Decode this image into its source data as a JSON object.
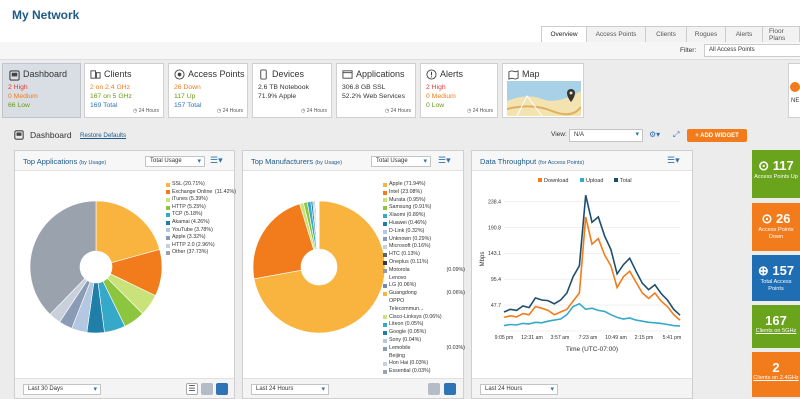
{
  "header": {
    "title": "My Network"
  },
  "tabs": [
    "Overview",
    "Access Points",
    "Clients",
    "Rogues",
    "Alerts",
    "Floor Plans"
  ],
  "filter": {
    "label": "Filter:",
    "value": "All Access Points"
  },
  "cards": {
    "dashboard": {
      "label": "Dashboard"
    },
    "clients": {
      "title": "Clients",
      "l1": "2 on 2.4 GHz",
      "l2": "167 on 5 GHz",
      "l3": "169 Total",
      "time": "24 Hours"
    },
    "access_points": {
      "title": "Access Points",
      "l1": "26 Down",
      "l2": "117 Up",
      "l3": "157 Total",
      "time": "24 Hours"
    },
    "devices": {
      "title": "Devices",
      "l1": "2.6 TB Notebook",
      "l2": "71.9% Apple",
      "time": "24 Hours"
    },
    "applications": {
      "title": "Applications",
      "l1": "306.8 GB SSL",
      "l2": "52.2% Web Services",
      "time": "24 Hours"
    },
    "alerts": {
      "title": "Alerts",
      "l1": "2 High",
      "l2": "0 Medium",
      "l3": "0 Low",
      "time": "24 Hours"
    },
    "map": {
      "title": "Map"
    },
    "partial": {
      "label": "NE"
    }
  },
  "dashboard_left": {
    "high": "2 High",
    "medium": "0 Medium",
    "low": "66 Low"
  },
  "dashbar": {
    "title": "Dashboard",
    "restore": "Restore Defaults",
    "view_label": "View:",
    "view_value": "N/A",
    "add_widget": "+ ADD WIDGET"
  },
  "panel_apps": {
    "title": "Top Applications",
    "sub": "(by Usage)",
    "select": "Total Usage",
    "footer_select": "Last 30 Days",
    "legend": [
      {
        "label": "SSL (20.71%)",
        "color": "#f9b43f"
      },
      {
        "label": "Exchange Online",
        "pct": "(11.42%)",
        "color": "#f27c1b"
      },
      {
        "label": "iTunes (5.39%)",
        "color": "#c9e37a"
      },
      {
        "label": "HTTP (5.25%)",
        "color": "#8cc63f"
      },
      {
        "label": "TCP (5.18%)",
        "color": "#36a9c9"
      },
      {
        "label": "Akamai (4.26%)",
        "color": "#1f7fa8"
      },
      {
        "label": "YouTube (3.78%)",
        "color": "#b3c7e0"
      },
      {
        "label": "Apple (3.32%)",
        "color": "#8a9bb5"
      },
      {
        "label": "HTTP 2.0 (2.96%)",
        "color": "#c8d0db"
      },
      {
        "label": "Other (37.73%)",
        "color": "#9aa3ad"
      }
    ]
  },
  "panel_mfr": {
    "title": "Top Manufacturers",
    "sub": "(by Usage)",
    "select": "Total Usage",
    "footer_select": "Last 24 Hours",
    "legend": [
      {
        "label": "Apple (71.94%)",
        "color": "#f9b43f"
      },
      {
        "label": "Intel (23.08%)",
        "color": "#f27c1b"
      },
      {
        "label": "Murata (0.95%)",
        "color": "#c9e37a"
      },
      {
        "label": "Samsung (0.91%)",
        "color": "#8cc63f"
      },
      {
        "label": "Xiaomi (0.89%)",
        "color": "#36a9c9"
      },
      {
        "label": "Huawei (0.46%)",
        "color": "#1f7fa8"
      },
      {
        "label": "D-Link (0.32%)",
        "color": "#b3c7e0"
      },
      {
        "label": "Unknown (0.29%)",
        "color": "#8a9bb5"
      },
      {
        "label": "Microsoft (0.16%)",
        "color": "#c8d0db"
      },
      {
        "label": "HTC (0.13%)",
        "color": "#5a6470"
      },
      {
        "label": "Oneplus (0.11%)",
        "color": "#2b3a55"
      },
      {
        "label": "Motorola",
        "pct": "(0.09%)",
        "color": "#8a9bb5"
      },
      {
        "label": "Lenovo",
        "pct": "",
        "color": ""
      },
      {
        "label": "LG (0.06%)",
        "color": "#6e8bb5"
      },
      {
        "label": "Guangdong",
        "pct": "(0.06%)",
        "color": "#f9b43f"
      },
      {
        "label": "OPPO",
        "pct": "",
        "color": ""
      },
      {
        "label": "Telecommun...",
        "pct": "",
        "color": ""
      },
      {
        "label": "Cisco-Linksys (0.06%)",
        "color": "#c9e37a"
      },
      {
        "label": "Liteon (0.05%)",
        "color": "#36a9c9"
      },
      {
        "label": "Google (0.05%)",
        "color": "#1f7fa8"
      },
      {
        "label": "Sony (0.04%)",
        "color": "#b3c7e0"
      },
      {
        "label": "Lemobile",
        "pct": "(0.03%)",
        "color": "#8a9bb5"
      },
      {
        "label": "Beijing",
        "pct": "",
        "color": ""
      },
      {
        "label": "Hon Hai (0.03%)",
        "color": "#c8d0db"
      },
      {
        "label": "Essential (0.03%)",
        "color": "#9aa3ad"
      }
    ]
  },
  "panel_tp": {
    "title": "Data Throughput",
    "sub": "(for Access Points)",
    "footer_select": "Last 24 Hours"
  },
  "chart_data": [
    {
      "type": "pie",
      "title": "Top Applications",
      "categories": [
        "SSL",
        "Exchange Online",
        "iTunes",
        "HTTP",
        "TCP",
        "Akamai",
        "YouTube",
        "Apple",
        "HTTP 2.0",
        "Other"
      ],
      "values": [
        20.71,
        11.42,
        5.39,
        5.25,
        5.18,
        4.26,
        3.78,
        3.32,
        2.96,
        37.73
      ]
    },
    {
      "type": "pie",
      "title": "Top Manufacturers",
      "categories": [
        "Apple",
        "Intel",
        "Murata",
        "Samsung",
        "Xiaomi",
        "Huawei",
        "D-Link",
        "Unknown",
        "Microsoft",
        "HTC",
        "Oneplus",
        "Motorola Lenovo",
        "LG",
        "Guangdong OPPO Telecommun...",
        "Cisco-Linksys",
        "Liteon",
        "Google",
        "Sony",
        "Lemobile Beijing",
        "Hon Hai",
        "Essential"
      ],
      "values": [
        71.94,
        23.08,
        0.95,
        0.91,
        0.89,
        0.46,
        0.32,
        0.29,
        0.16,
        0.13,
        0.11,
        0.09,
        0.06,
        0.06,
        0.06,
        0.05,
        0.05,
        0.04,
        0.03,
        0.03,
        0.03
      ]
    },
    {
      "type": "line",
      "title": "Data Throughput",
      "xlabel": "Time (UTC-07:00)",
      "ylabel": "Mbps",
      "x_ticks": [
        "9:05 pm",
        "12:31 am",
        "3:57 am",
        "7:23 am",
        "10:49 am",
        "2:15 pm",
        "5:41 pm"
      ],
      "y_ticks": [
        0,
        47.7,
        95.4,
        143.1,
        190.8,
        238.4
      ],
      "ylim": [
        0,
        265
      ],
      "series": [
        {
          "name": "Download",
          "color": "#f27c1b",
          "values": [
            25,
            28,
            26,
            32,
            30,
            45,
            42,
            38,
            30,
            35,
            40,
            55,
            70,
            210,
            160,
            170,
            140,
            120,
            80,
            100,
            110,
            90,
            70,
            60,
            70,
            55,
            45,
            30,
            20
          ]
        },
        {
          "name": "Upload",
          "color": "#36a9c9",
          "values": [
            10,
            12,
            11,
            14,
            13,
            16,
            15,
            18,
            20,
            22,
            30,
            45,
            50,
            40,
            42,
            38,
            36,
            30,
            25,
            22,
            24,
            20,
            18,
            16,
            15,
            14,
            12,
            10,
            9
          ]
        },
        {
          "name": "Total",
          "color": "#1d4e6e",
          "values": [
            35,
            40,
            38,
            46,
            43,
            61,
            57,
            56,
            50,
            57,
            70,
            100,
            120,
            250,
            200,
            210,
            175,
            150,
            105,
            122,
            134,
            110,
            88,
            76,
            85,
            69,
            57,
            40,
            29
          ]
        }
      ]
    }
  ],
  "tiles": [
    {
      "big": "117",
      "sm": "Access Points Up",
      "icon": "⊙",
      "color": "#6aa31c"
    },
    {
      "big": "26",
      "sm": "Access Points Down",
      "icon": "⊙",
      "color": "#f27c1b"
    },
    {
      "big": "157",
      "sm": "Total Access Points",
      "icon": "⊕",
      "color": "#1f6db3"
    },
    {
      "big": "167",
      "sm": "Clients on 5GHz",
      "icon": "",
      "color": "#6aa31c"
    },
    {
      "big": "2",
      "sm": "Clients on 2.4GHz",
      "icon": "",
      "color": "#f27c1b"
    }
  ]
}
